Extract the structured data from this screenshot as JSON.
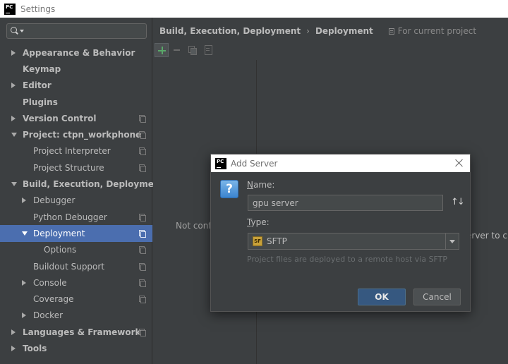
{
  "window": {
    "title": "Settings",
    "logo": "PC"
  },
  "search": {
    "placeholder": ""
  },
  "tree": [
    {
      "label": "Appearance & Behavior",
      "level": 0,
      "bold": true,
      "arrow": "right",
      "copy": false
    },
    {
      "label": "Keymap",
      "level": 0,
      "bold": true,
      "arrow": "",
      "copy": false
    },
    {
      "label": "Editor",
      "level": 0,
      "bold": true,
      "arrow": "right",
      "copy": false
    },
    {
      "label": "Plugins",
      "level": 0,
      "bold": true,
      "arrow": "",
      "copy": false
    },
    {
      "label": "Version Control",
      "level": 0,
      "bold": true,
      "arrow": "right",
      "copy": true
    },
    {
      "label": "Project: ctpn_workphone",
      "level": 0,
      "bold": true,
      "arrow": "down",
      "copy": true
    },
    {
      "label": "Project Interpreter",
      "level": 1,
      "bold": false,
      "arrow": "",
      "copy": true
    },
    {
      "label": "Project Structure",
      "level": 1,
      "bold": false,
      "arrow": "",
      "copy": true
    },
    {
      "label": "Build, Execution, Deployment",
      "level": 0,
      "bold": true,
      "arrow": "down",
      "copy": false
    },
    {
      "label": "Debugger",
      "level": 1,
      "bold": false,
      "arrow": "right",
      "copy": false
    },
    {
      "label": "Python Debugger",
      "level": 1,
      "bold": false,
      "arrow": "",
      "copy": true
    },
    {
      "label": "Deployment",
      "level": 1,
      "bold": false,
      "arrow": "down",
      "copy": true,
      "selected": true
    },
    {
      "label": "Options",
      "level": 2,
      "bold": false,
      "arrow": "",
      "copy": true
    },
    {
      "label": "Buildout Support",
      "level": 1,
      "bold": false,
      "arrow": "",
      "copy": true
    },
    {
      "label": "Console",
      "level": 1,
      "bold": false,
      "arrow": "right",
      "copy": true
    },
    {
      "label": "Coverage",
      "level": 1,
      "bold": false,
      "arrow": "",
      "copy": true
    },
    {
      "label": "Docker",
      "level": 1,
      "bold": false,
      "arrow": "right",
      "copy": false
    },
    {
      "label": "Languages & Frameworks",
      "level": 0,
      "bold": true,
      "arrow": "right",
      "copy": true
    },
    {
      "label": "Tools",
      "level": 0,
      "bold": true,
      "arrow": "right",
      "copy": false
    }
  ],
  "main": {
    "breadcrumb": [
      "Build, Execution, Deployment",
      "Deployment"
    ],
    "breadcrumb_sep": "›",
    "scope": "For current project",
    "not_configured": "Not configured",
    "bg_right_text": "erver to c"
  },
  "dialog": {
    "title": "Add Server",
    "logo": "PC",
    "question": "?",
    "name_label_first": "N",
    "name_label_rest": "ame:",
    "name_value": "gpu server",
    "sort_glyph": "↑↓",
    "type_label_first": "T",
    "type_label_rest": "ype:",
    "type_icon_text": "SF",
    "type_value": "SFTP",
    "hint": "Project files are deployed to a remote host via SFTP",
    "ok_label": "OK",
    "cancel_label": "Cancel"
  }
}
